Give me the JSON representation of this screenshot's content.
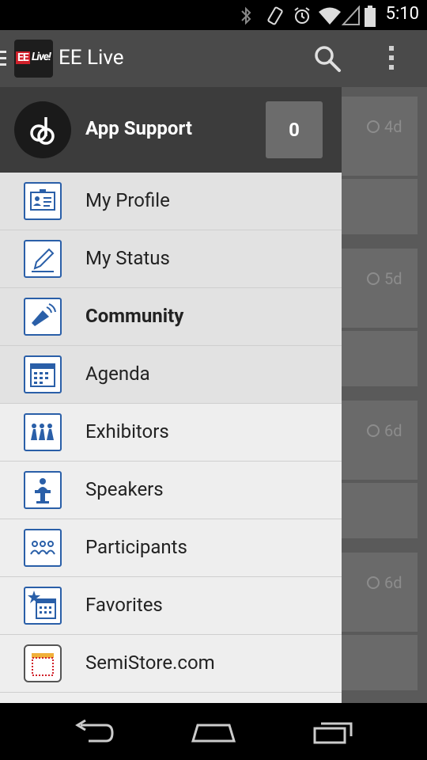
{
  "status_bar": {
    "time": "5:10"
  },
  "action_bar": {
    "logo_ee": "EE",
    "logo_live": "Live!",
    "title": "EE Live"
  },
  "drawer": {
    "header": {
      "title": "App Support",
      "count": "0"
    },
    "items": [
      {
        "label": "My Profile",
        "icon": "profile-card-icon"
      },
      {
        "label": "My Status",
        "icon": "pencil-icon"
      },
      {
        "label": "Community",
        "icon": "megaphone-icon"
      },
      {
        "label": "Agenda",
        "icon": "calendar-icon"
      },
      {
        "label": "Exhibitors",
        "icon": "exhibitors-icon"
      },
      {
        "label": "Speakers",
        "icon": "podium-icon"
      },
      {
        "label": "Participants",
        "icon": "people-icon"
      },
      {
        "label": "Favorites",
        "icon": "star-calendar-icon"
      },
      {
        "label": "SemiStore.com",
        "icon": "store-icon"
      }
    ]
  },
  "background_cards": [
    {
      "time": "4d"
    },
    {
      "time": "5d"
    },
    {
      "time": "6d"
    },
    {
      "time": "6d"
    }
  ],
  "colors": {
    "action_bar": "#4a4a4a",
    "drawer_header": "#3c3c3c",
    "icon_blue": "#2a5fa8"
  }
}
